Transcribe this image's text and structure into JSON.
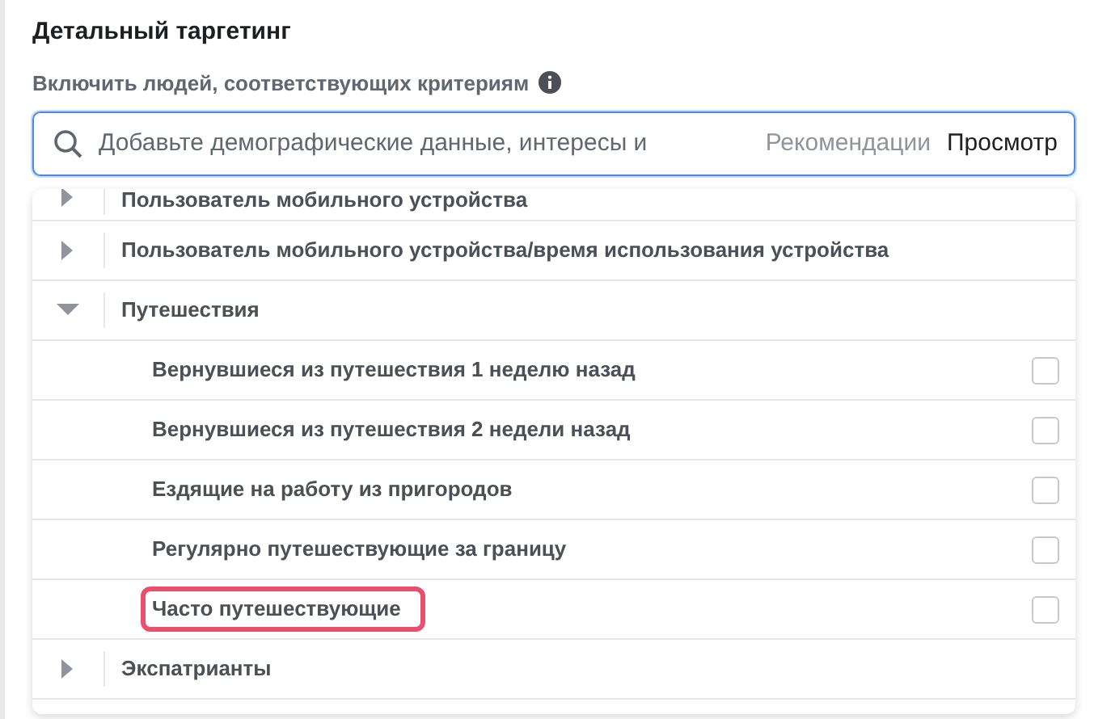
{
  "title": "Детальный таргетинг",
  "subtitle": "Включить людей, соответствующих критериям",
  "search": {
    "placeholder": "Добавьте демографические данные, интересы и",
    "suggestions_link": "Рекомендации",
    "browse_link": "Просмотр"
  },
  "categories": [
    {
      "label": "Пользователь мобильного устройства",
      "expanded": false
    },
    {
      "label": "Пользователь мобильного устройства/время использования устройства",
      "expanded": false
    },
    {
      "label": "Путешествия",
      "expanded": true,
      "children": [
        {
          "label": "Вернувшиеся из путешествия 1 неделю назад",
          "checked": false,
          "highlighted": false
        },
        {
          "label": "Вернувшиеся из путешествия 2 недели назад",
          "checked": false,
          "highlighted": false
        },
        {
          "label": "Ездящие на работу из пригородов",
          "checked": false,
          "highlighted": false
        },
        {
          "label": "Регулярно путешествующие за границу",
          "checked": false,
          "highlighted": false
        },
        {
          "label": "Часто путешествующие",
          "checked": false,
          "highlighted": true
        }
      ]
    },
    {
      "label": "Экспатрианты",
      "expanded": false
    }
  ]
}
